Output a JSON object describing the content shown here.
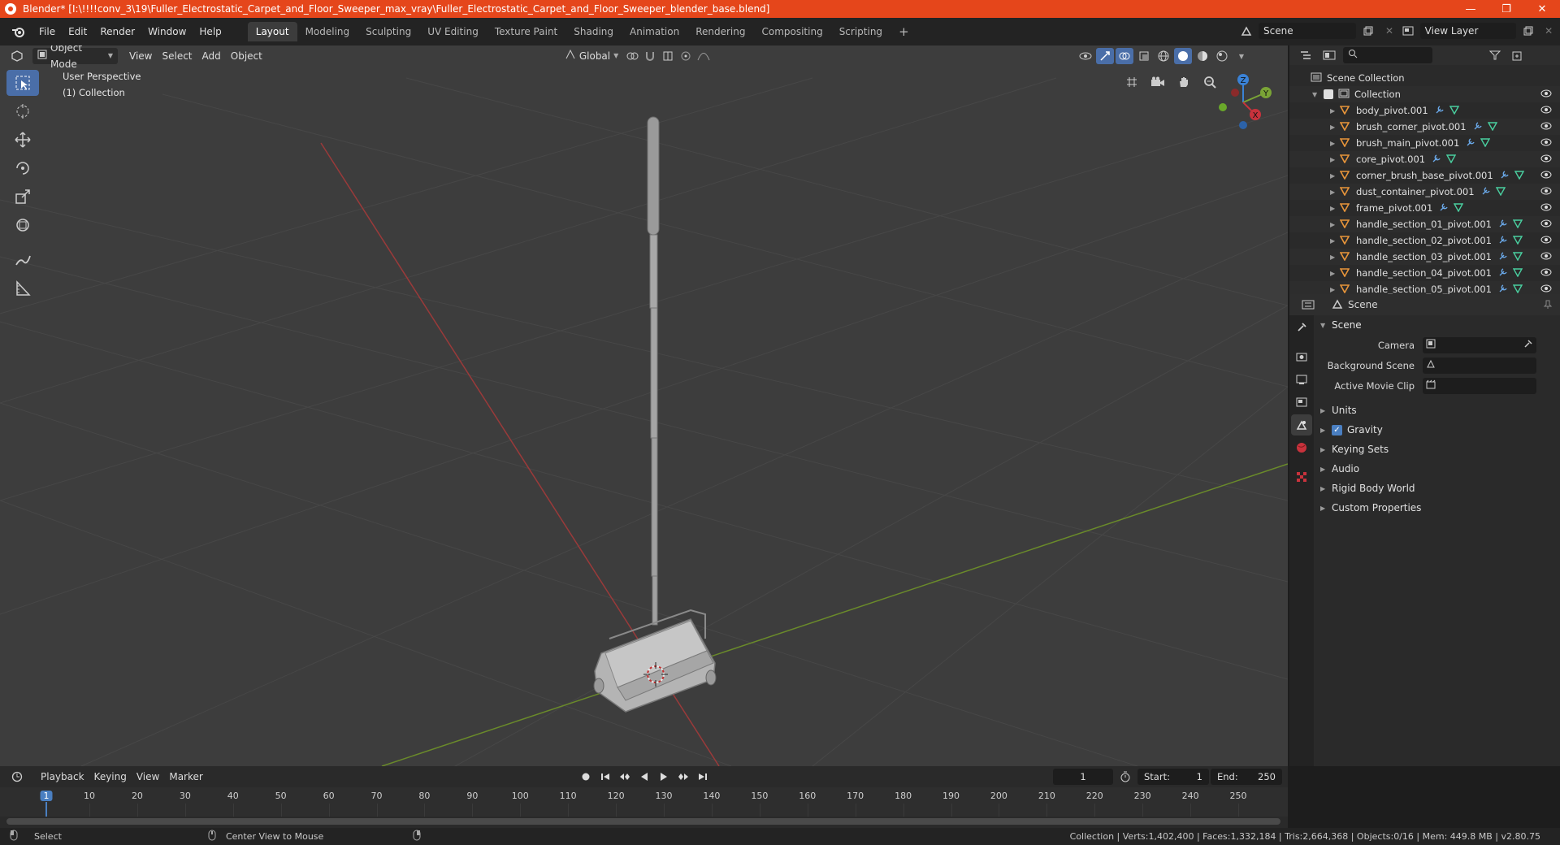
{
  "window": {
    "title": "Blender* [I:\\!!!!conv_3\\19\\Fuller_Electrostatic_Carpet_and_Floor_Sweeper_max_vray\\Fuller_Electrostatic_Carpet_and_Floor_Sweeper_blender_base.blend]",
    "minimize": "—",
    "restore": "❐",
    "close": "✕"
  },
  "menus": [
    "File",
    "Edit",
    "Render",
    "Window",
    "Help"
  ],
  "workspaces": [
    "Layout",
    "Modeling",
    "Sculpting",
    "UV Editing",
    "Texture Paint",
    "Shading",
    "Animation",
    "Rendering",
    "Compositing",
    "Scripting"
  ],
  "add_workspace": "+",
  "scene_selector": "Scene",
  "view_layer_selector": "View Layer",
  "viewport": {
    "mode": "Object Mode",
    "menus": [
      "View",
      "Select",
      "Add",
      "Object"
    ],
    "transform_orientation": "Global",
    "info_line1": "User Perspective",
    "info_line2": "(1) Collection",
    "gizmo": {
      "x": "X",
      "y": "Y",
      "z": "Z"
    }
  },
  "outliner": {
    "root": "Scene Collection",
    "collection": "Collection",
    "items": [
      "body_pivot.001",
      "brush_corner_pivot.001",
      "brush_main_pivot.001",
      "core_pivot.001",
      "corner_brush_base_pivot.001",
      "dust_container_pivot.001",
      "frame_pivot.001",
      "handle_section_01_pivot.001",
      "handle_section_02_pivot.001",
      "handle_section_03_pivot.001",
      "handle_section_04_pivot.001",
      "handle_section_05_pivot.001"
    ]
  },
  "properties": {
    "context": "Scene",
    "panel": "Scene",
    "fields": [
      {
        "label": "Camera",
        "value": ""
      },
      {
        "label": "Background Scene",
        "value": ""
      },
      {
        "label": "Active Movie Clip",
        "value": ""
      }
    ],
    "subpanels": [
      "Units",
      "Gravity",
      "Keying Sets",
      "Audio",
      "Rigid Body World",
      "Custom Properties"
    ],
    "gravity_checked": true
  },
  "timeline": {
    "menus": [
      "Playback",
      "Keying",
      "View",
      "Marker"
    ],
    "current_frame": "1",
    "start_label": "Start:",
    "start": "1",
    "end_label": "End:",
    "end": "250",
    "ticks": [
      "1",
      "10",
      "20",
      "30",
      "40",
      "50",
      "60",
      "70",
      "80",
      "90",
      "100",
      "110",
      "120",
      "130",
      "140",
      "150",
      "160",
      "170",
      "180",
      "190",
      "200",
      "210",
      "220",
      "230",
      "240",
      "250"
    ]
  },
  "status": {
    "select": "Select",
    "center_view": "Center View to Mouse",
    "stats": "Collection | Verts:1,402,400 | Faces:1,332,184 | Tris:2,664,368 | Objects:0/16 | Mem: 449.8 MB | v2.80.75"
  },
  "colors": {
    "title_bar": "#e5461b",
    "accent": "#4a7fc1",
    "x_axis": "#c8323c",
    "y_axis": "#7aa436",
    "z_axis": "#3a82d6"
  }
}
